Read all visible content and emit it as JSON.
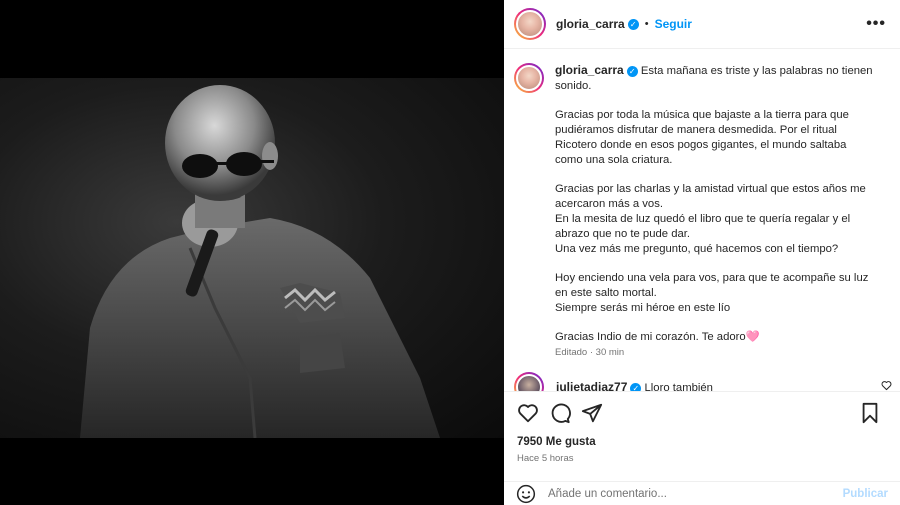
{
  "post": {
    "author": "gloria_carra",
    "follow_label": "Seguir",
    "separator": "•",
    "more_label": "•••"
  },
  "caption": {
    "p1": "Esta mañana es triste y las palabras no tienen sonido.",
    "p2": "Gracias por toda la música que bajaste a la tierra para que pudiéramos disfrutar de manera desmedida. Por el ritual Ricotero donde en esos pogos gigantes, el mundo saltaba como una sola criatura.",
    "p3": "Gracias por las charlas y la amistad virtual que estos años me acercaron más a vos.",
    "p4": "En la mesita de luz quedó el libro que te quería regalar y el abrazo que no te pude dar.",
    "p5": "Una vez más me pregunto, qué hacemos con el tiempo?",
    "p6": "Hoy enciendo una vela para vos, para que te acompañe su luz en este salto mortal.",
    "p7": "Siempre serás mi héroe en este lío",
    "p8": "Gracias Indio de mi corazón. Te adoro🩷",
    "edited": "Editado · 30 min"
  },
  "comment": {
    "author": "julietadiaz77",
    "text": "Lloro también"
  },
  "stats": {
    "likes": "7950 Me gusta",
    "time_ago": "Hace 5 horas"
  },
  "composer": {
    "placeholder": "Añade un comentario...",
    "publish_label": "Publicar"
  },
  "icons": [
    "heart-icon",
    "comment-icon",
    "share-icon",
    "bookmark-icon",
    "emoji-icon",
    "verified-icon",
    "more-icon"
  ],
  "colors": {
    "accent": "#0095f6",
    "publish_disabled": "#b3dbff",
    "muted": "#737373"
  }
}
